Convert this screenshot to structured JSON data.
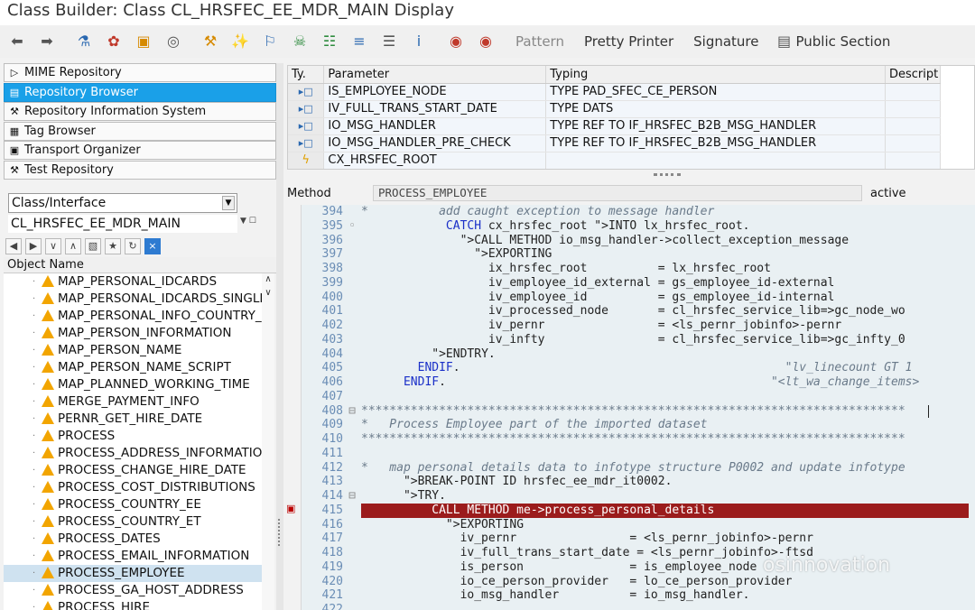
{
  "window": {
    "title": "Class Builder: Class CL_HRSFEC_EE_MDR_MAIN Display"
  },
  "toolbar": {
    "buttons": [
      {
        "name": "back",
        "glyph": "⬅"
      },
      {
        "name": "forward",
        "glyph": "➡"
      },
      {
        "name": "other-object",
        "glyph": "⚗"
      },
      {
        "name": "display-change",
        "glyph": "✿"
      },
      {
        "name": "active-inactive",
        "glyph": "▣"
      },
      {
        "name": "where-used",
        "glyph": "◎"
      },
      {
        "name": "object-list",
        "glyph": "⚒"
      },
      {
        "name": "check",
        "glyph": "✨"
      },
      {
        "name": "activate",
        "glyph": "⚐"
      },
      {
        "name": "test",
        "glyph": "☠"
      },
      {
        "name": "hierarchy",
        "glyph": "☷"
      },
      {
        "name": "display-list",
        "glyph": "≡"
      },
      {
        "name": "documentation",
        "glyph": "☰"
      },
      {
        "name": "info",
        "glyph": "i"
      },
      {
        "name": "set-breakpoint",
        "glyph": "◉"
      },
      {
        "name": "watchpoint",
        "glyph": "◉"
      }
    ],
    "pattern": "Pattern",
    "pretty_printer": "Pretty Printer",
    "signature": "Signature",
    "public_section": "Public Section"
  },
  "nav": [
    {
      "label": "MIME Repository",
      "icon": "▷",
      "active": false
    },
    {
      "label": "Repository Browser",
      "icon": "▤",
      "active": true
    },
    {
      "label": "Repository Information System",
      "icon": "⚒",
      "active": false
    },
    {
      "label": "Tag Browser",
      "icon": "▦",
      "active": false
    },
    {
      "label": "Transport Organizer",
      "icon": "▣",
      "active": false
    },
    {
      "label": "Test Repository",
      "icon": "⚒",
      "active": false
    }
  ],
  "object": {
    "type": "Class/Interface",
    "name": "CL_HRSFEC_EE_MDR_MAIN"
  },
  "tree": {
    "header": "Object Name",
    "items": [
      "MAP_PERSONAL_IDCARDS",
      "MAP_PERSONAL_IDCARDS_SINGLE",
      "MAP_PERSONAL_INFO_COUNTRY_FL",
      "MAP_PERSON_INFORMATION",
      "MAP_PERSON_NAME",
      "MAP_PERSON_NAME_SCRIPT",
      "MAP_PLANNED_WORKING_TIME",
      "MERGE_PAYMENT_INFO",
      "PERNR_GET_HIRE_DATE",
      "PROCESS",
      "PROCESS_ADDRESS_INFORMATION",
      "PROCESS_CHANGE_HIRE_DATE",
      "PROCESS_COST_DISTRIBUTIONS",
      "PROCESS_COUNTRY_EE",
      "PROCESS_COUNTRY_ET",
      "PROCESS_DATES",
      "PROCESS_EMAIL_INFORMATION",
      "PROCESS_EMPLOYEE",
      "PROCESS_GA_HOST_ADDRESS",
      "PROCESS_HIRE"
    ],
    "selected_index": 17
  },
  "params": {
    "headers": {
      "ty": "Ty.",
      "parameter": "Parameter",
      "typing": "Typing",
      "descript": "Descript"
    },
    "rows": [
      {
        "ty": "▸□",
        "parameter": "IS_EMPLOYEE_NODE",
        "typing": "TYPE PAD_SFEC_CE_PERSON",
        "kind": "import"
      },
      {
        "ty": "▸□",
        "parameter": "IV_FULL_TRANS_START_DATE",
        "typing": "TYPE DATS",
        "kind": "import"
      },
      {
        "ty": "▸□",
        "parameter": "IO_MSG_HANDLER",
        "typing": "TYPE REF TO IF_HRSFEC_B2B_MSG_HANDLER",
        "kind": "import"
      },
      {
        "ty": "▸□",
        "parameter": "IO_MSG_HANDLER_PRE_CHECK",
        "typing": "TYPE REF TO IF_HRSFEC_B2B_MSG_HANDLER",
        "kind": "import"
      },
      {
        "ty": "ϟ",
        "parameter": "CX_HRSFEC_ROOT",
        "typing": "",
        "kind": "exception"
      }
    ]
  },
  "method": {
    "label": "Method",
    "name": "PROCESS_EMPLOYEE",
    "status": "active"
  },
  "code": {
    "highlight_line": 415,
    "lines": [
      {
        "n": "394",
        "f": "",
        "t": "*          add caught exception to message handler",
        "style": "c"
      },
      {
        "n": "395",
        "f": "◦",
        "t": "            CATCH cx_hrsfec_root INTO lx_hrsfec_root.",
        "style": ""
      },
      {
        "n": "396",
        "f": "",
        "t": "              CALL METHOD io_msg_handler->collect_exception_message",
        "style": ""
      },
      {
        "n": "397",
        "f": "",
        "t": "                EXPORTING",
        "style": ""
      },
      {
        "n": "398",
        "f": "",
        "t": "                  ix_hrsfec_root          = lx_hrsfec_root",
        "style": ""
      },
      {
        "n": "399",
        "f": "",
        "t": "                  iv_employee_id_external = gs_employee_id-external",
        "style": ""
      },
      {
        "n": "400",
        "f": "",
        "t": "                  iv_employee_id          = gs_employee_id-internal",
        "style": ""
      },
      {
        "n": "401",
        "f": "",
        "t": "                  iv_processed_node       = cl_hrsfec_service_lib=>gc_node_wo",
        "style": ""
      },
      {
        "n": "402",
        "f": "",
        "t": "                  iv_pernr                = <ls_pernr_jobinfo>-pernr",
        "style": ""
      },
      {
        "n": "403",
        "f": "",
        "t": "                  iv_infty                = cl_hrsfec_service_lib=>gc_infty_0",
        "style": ""
      },
      {
        "n": "404",
        "f": "",
        "t": "          ENDTRY.",
        "style": ""
      },
      {
        "n": "405",
        "f": "",
        "t": "        ENDIF.                                              \"lv_linecount GT 1",
        "style": ""
      },
      {
        "n": "406",
        "f": "",
        "t": "      ENDIF.                                              \"<lt_wa_change_items>",
        "style": ""
      },
      {
        "n": "407",
        "f": "",
        "t": "",
        "style": ""
      },
      {
        "n": "408",
        "f": "⊟",
        "t": "*****************************************************************************",
        "style": "c"
      },
      {
        "n": "409",
        "f": "",
        "t": "*   Process Employee part of the imported dataset",
        "style": "c"
      },
      {
        "n": "410",
        "f": "",
        "t": "*****************************************************************************",
        "style": "c"
      },
      {
        "n": "411",
        "f": "",
        "t": "",
        "style": ""
      },
      {
        "n": "412",
        "f": "",
        "t": "*   map personal details data to infotype structure P0002 and update infotype",
        "style": "c"
      },
      {
        "n": "413",
        "f": "",
        "t": "      BREAK-POINT ID hrsfec_ee_mdr_it0002.",
        "style": ""
      },
      {
        "n": "414",
        "f": "⊟",
        "t": "      TRY.",
        "style": ""
      },
      {
        "n": "415",
        "f": "",
        "t": "          CALL METHOD me->process_personal_details                                    ",
        "style": ""
      },
      {
        "n": "416",
        "f": "",
        "t": "            EXPORTING",
        "style": ""
      },
      {
        "n": "417",
        "f": "",
        "t": "              iv_pernr                = <ls_pernr_jobinfo>-pernr",
        "style": ""
      },
      {
        "n": "418",
        "f": "",
        "t": "              iv_full_trans_start_date = <ls_pernr_jobinfo>-ftsd",
        "style": ""
      },
      {
        "n": "419",
        "f": "",
        "t": "              is_person               = is_employee_node",
        "style": ""
      },
      {
        "n": "420",
        "f": "",
        "t": "              io_ce_person_provider   = lo_ce_person_provider",
        "style": ""
      },
      {
        "n": "421",
        "f": "",
        "t": "              io_msg_handler          = io_msg_handler.",
        "style": ""
      },
      {
        "n": "422",
        "f": "",
        "t": "",
        "style": ""
      }
    ]
  },
  "watermark": "osinnovation"
}
